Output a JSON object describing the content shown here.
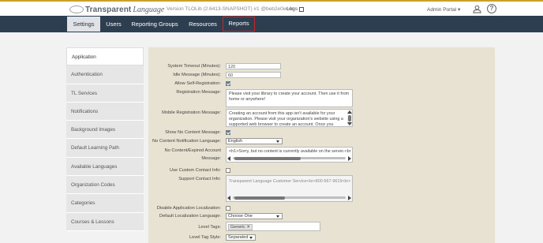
{
  "header": {
    "logo_main": "Transparent",
    "logo_sub": "Language",
    "version": "Version TLOLib (2.6413-SNAPSHOT) #1 @beb2e0ec4c",
    "logs": "Logs",
    "admin_portal": "Admin Portal ▾",
    "help": "?"
  },
  "nav": {
    "tabs": [
      "Settings",
      "Users",
      "Reporting Groups",
      "Resources",
      "Reports"
    ]
  },
  "sidebar": {
    "items": [
      "Application",
      "Authentication",
      "TL Services",
      "Notifications",
      "Background Images",
      "Default Learning Path",
      "Available Languages",
      "Organization Codes",
      "Categories",
      "Courses & Lessons"
    ]
  },
  "form": {
    "system_timeout_label": "System Timeout (Minutes):",
    "system_timeout_value": "120",
    "idle_message_label": "Idle Message (Minutes):",
    "idle_message_value": "60",
    "allow_self_reg_label": "Allow Self-Registration:",
    "allow_self_reg": true,
    "reg_message_label": "Registration Message:",
    "reg_message_value": "Please visit your library to create your account. Then use it from home or anywhere!",
    "mobile_reg_label": "Mobile Registration Message:",
    "mobile_reg_value": "Creating an account from this app isn't available for your organization. Please visit your organization's website using a supported web browser to create an account. Once you",
    "show_no_content_label": "Show No Content Message:",
    "show_no_content": true,
    "no_content_lang_label": "No Content Notification Language:",
    "no_content_lang_value": "English",
    "no_content_msg_label": "No Content/Expired Account Message:",
    "no_content_msg_value": "<h1>Sorry, but no content is currently available on the server.<br",
    "use_custom_contact_label": "Use Custom Contact Info:",
    "use_custom_contact": false,
    "support_contact_label": "Support Contact Info:",
    "support_contact_value": "Transparent Language Customer Service<br>800-567-9619<br>",
    "disable_localization_label": "Disable Application Localization:",
    "disable_localization": false,
    "default_localization_label": "Default Localization Language:",
    "default_localization_value": "Choose One",
    "level_tags_label": "Level Tags:",
    "level_tag": "Generic",
    "level_tag_remove": "✕",
    "level_tag_style_label": "Level Tag Style:",
    "level_tag_style_value": "Separated"
  },
  "colors": {
    "navbar": "#2c3e50",
    "accent_gold": "#c9a227",
    "active_tab_outline": "#c0282d",
    "content_bg": "#e8e2d2"
  }
}
